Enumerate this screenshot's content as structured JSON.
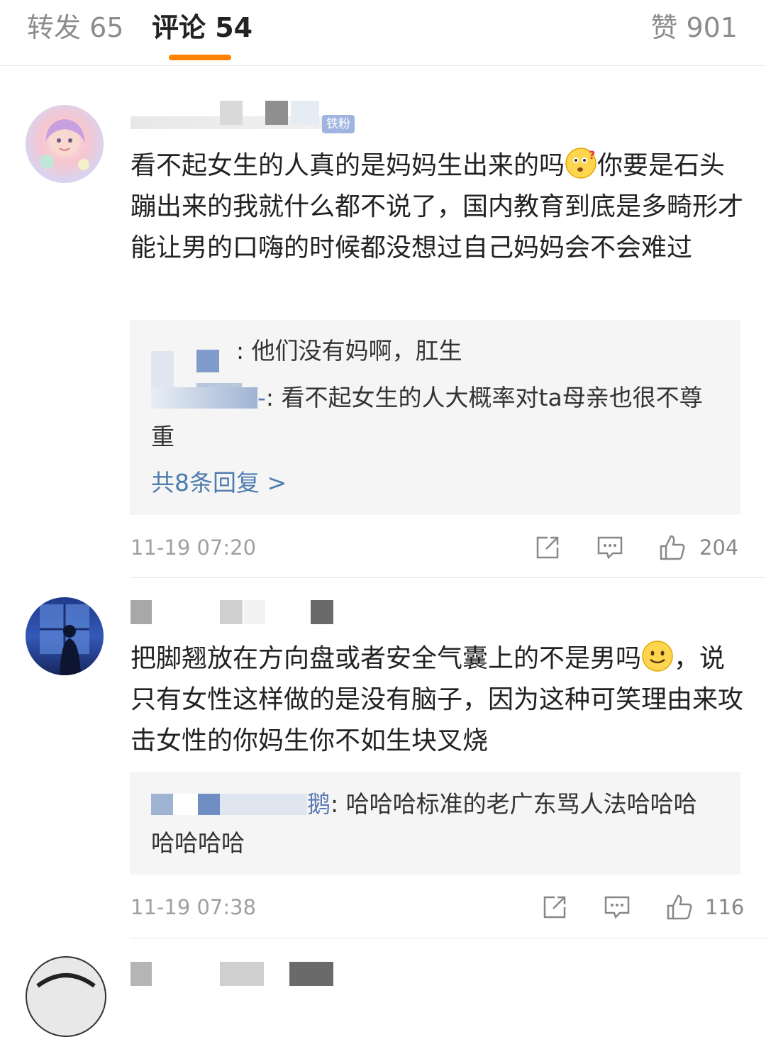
{
  "tabs": {
    "repost": "转发 65",
    "comments": "评论 54",
    "likes": "赞 901"
  },
  "colors": {
    "accent": "#ff8200",
    "link": "#507daf",
    "muted": "#a0a0a0"
  },
  "comments": [
    {
      "badge": "铁粉",
      "text_before_emoji": "看不起女生的人真的是妈妈生出来的吗",
      "emoji": "confused-face-emoji",
      "text_after_emoji": "你要是石头蹦出来的我就什么都不说了，国内教育到底是多畸形才能让男的口嗨的时候都没想过自己妈妈会不会难过",
      "replies": [
        {
          "name": "",
          "text": ": 他们没有妈啊，肛生"
        },
        {
          "name": "-",
          "text": ": 看不起女生的人大概率对ta母亲也很不尊重"
        }
      ],
      "more_replies": "共8条回复 >",
      "time": "11-19 07:20",
      "likes": "204"
    },
    {
      "text_line1": "把脚翘放在方向盘或者安全气囊上的不是男吗",
      "emoji": "smile-face-emoji",
      "text_after_emoji": "，说只有女性这样做的是没有脑子，因为这种可笑理由来攻击女性的你妈生你不如生块叉烧",
      "replies": [
        {
          "name": "鹅",
          "text": ": 哈哈哈标准的老广东骂人法哈哈哈哈哈哈哈"
        }
      ],
      "time": "11-19 07:38",
      "likes": "116"
    }
  ]
}
